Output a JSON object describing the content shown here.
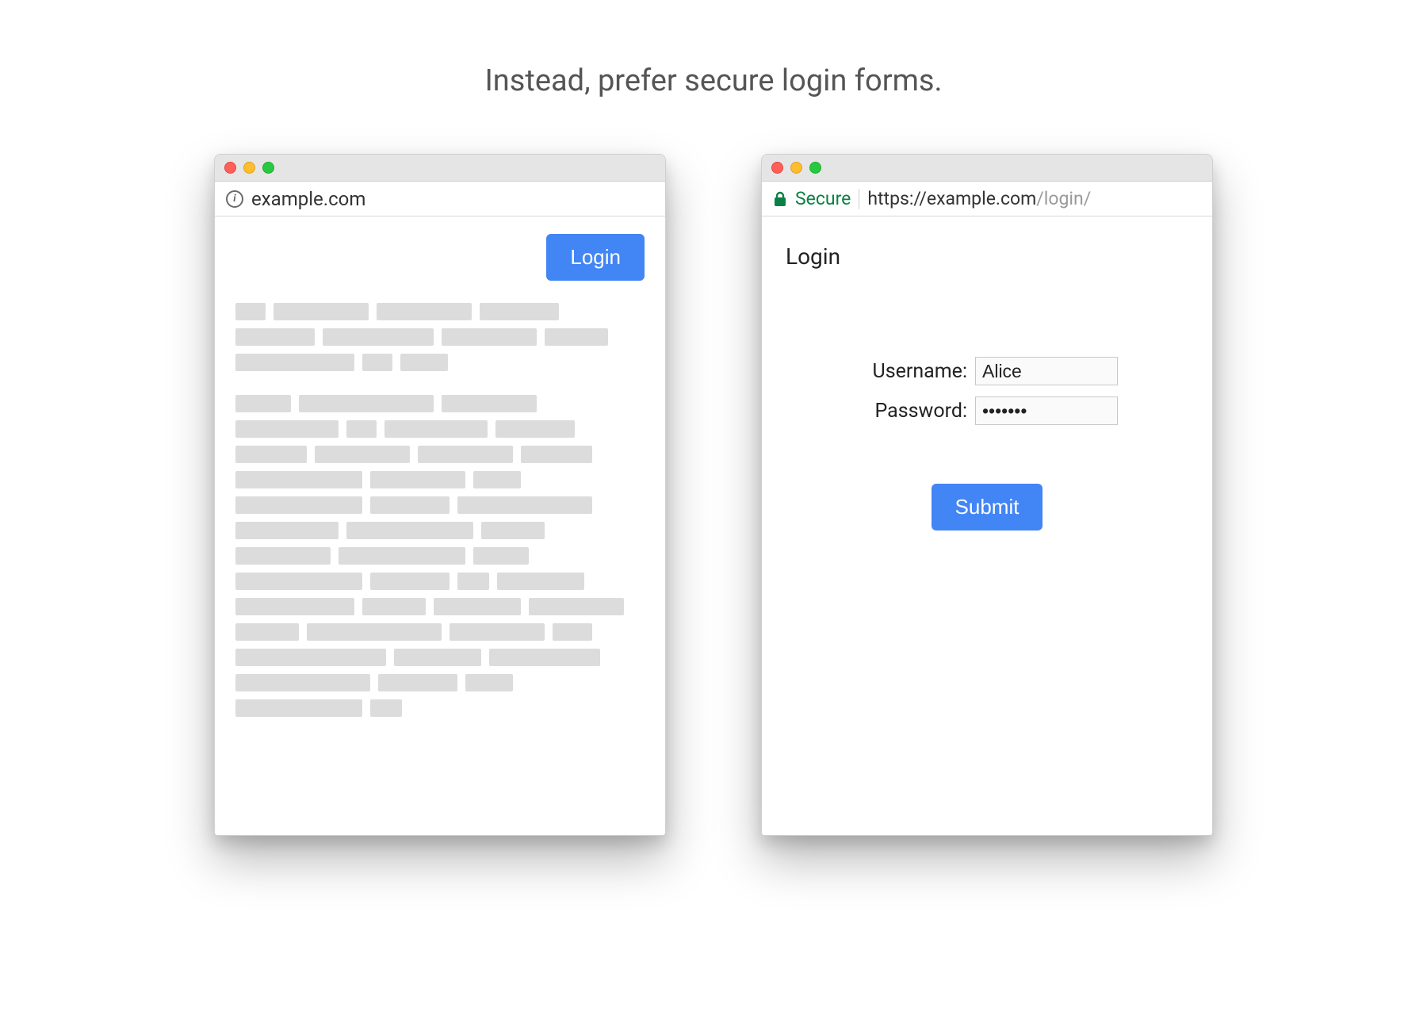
{
  "heading": "Instead, prefer secure login forms.",
  "left": {
    "addressbar": {
      "url": "example.com"
    },
    "login_button": "Login"
  },
  "right": {
    "addressbar": {
      "secure_label": "Secure",
      "url_scheme_host": "https://example.com",
      "url_path": "/login/"
    },
    "page_title": "Login",
    "form": {
      "username_label": "Username:",
      "username_value": "Alice",
      "password_label": "Password:",
      "password_value": "•••••••",
      "submit_label": "Submit"
    }
  }
}
